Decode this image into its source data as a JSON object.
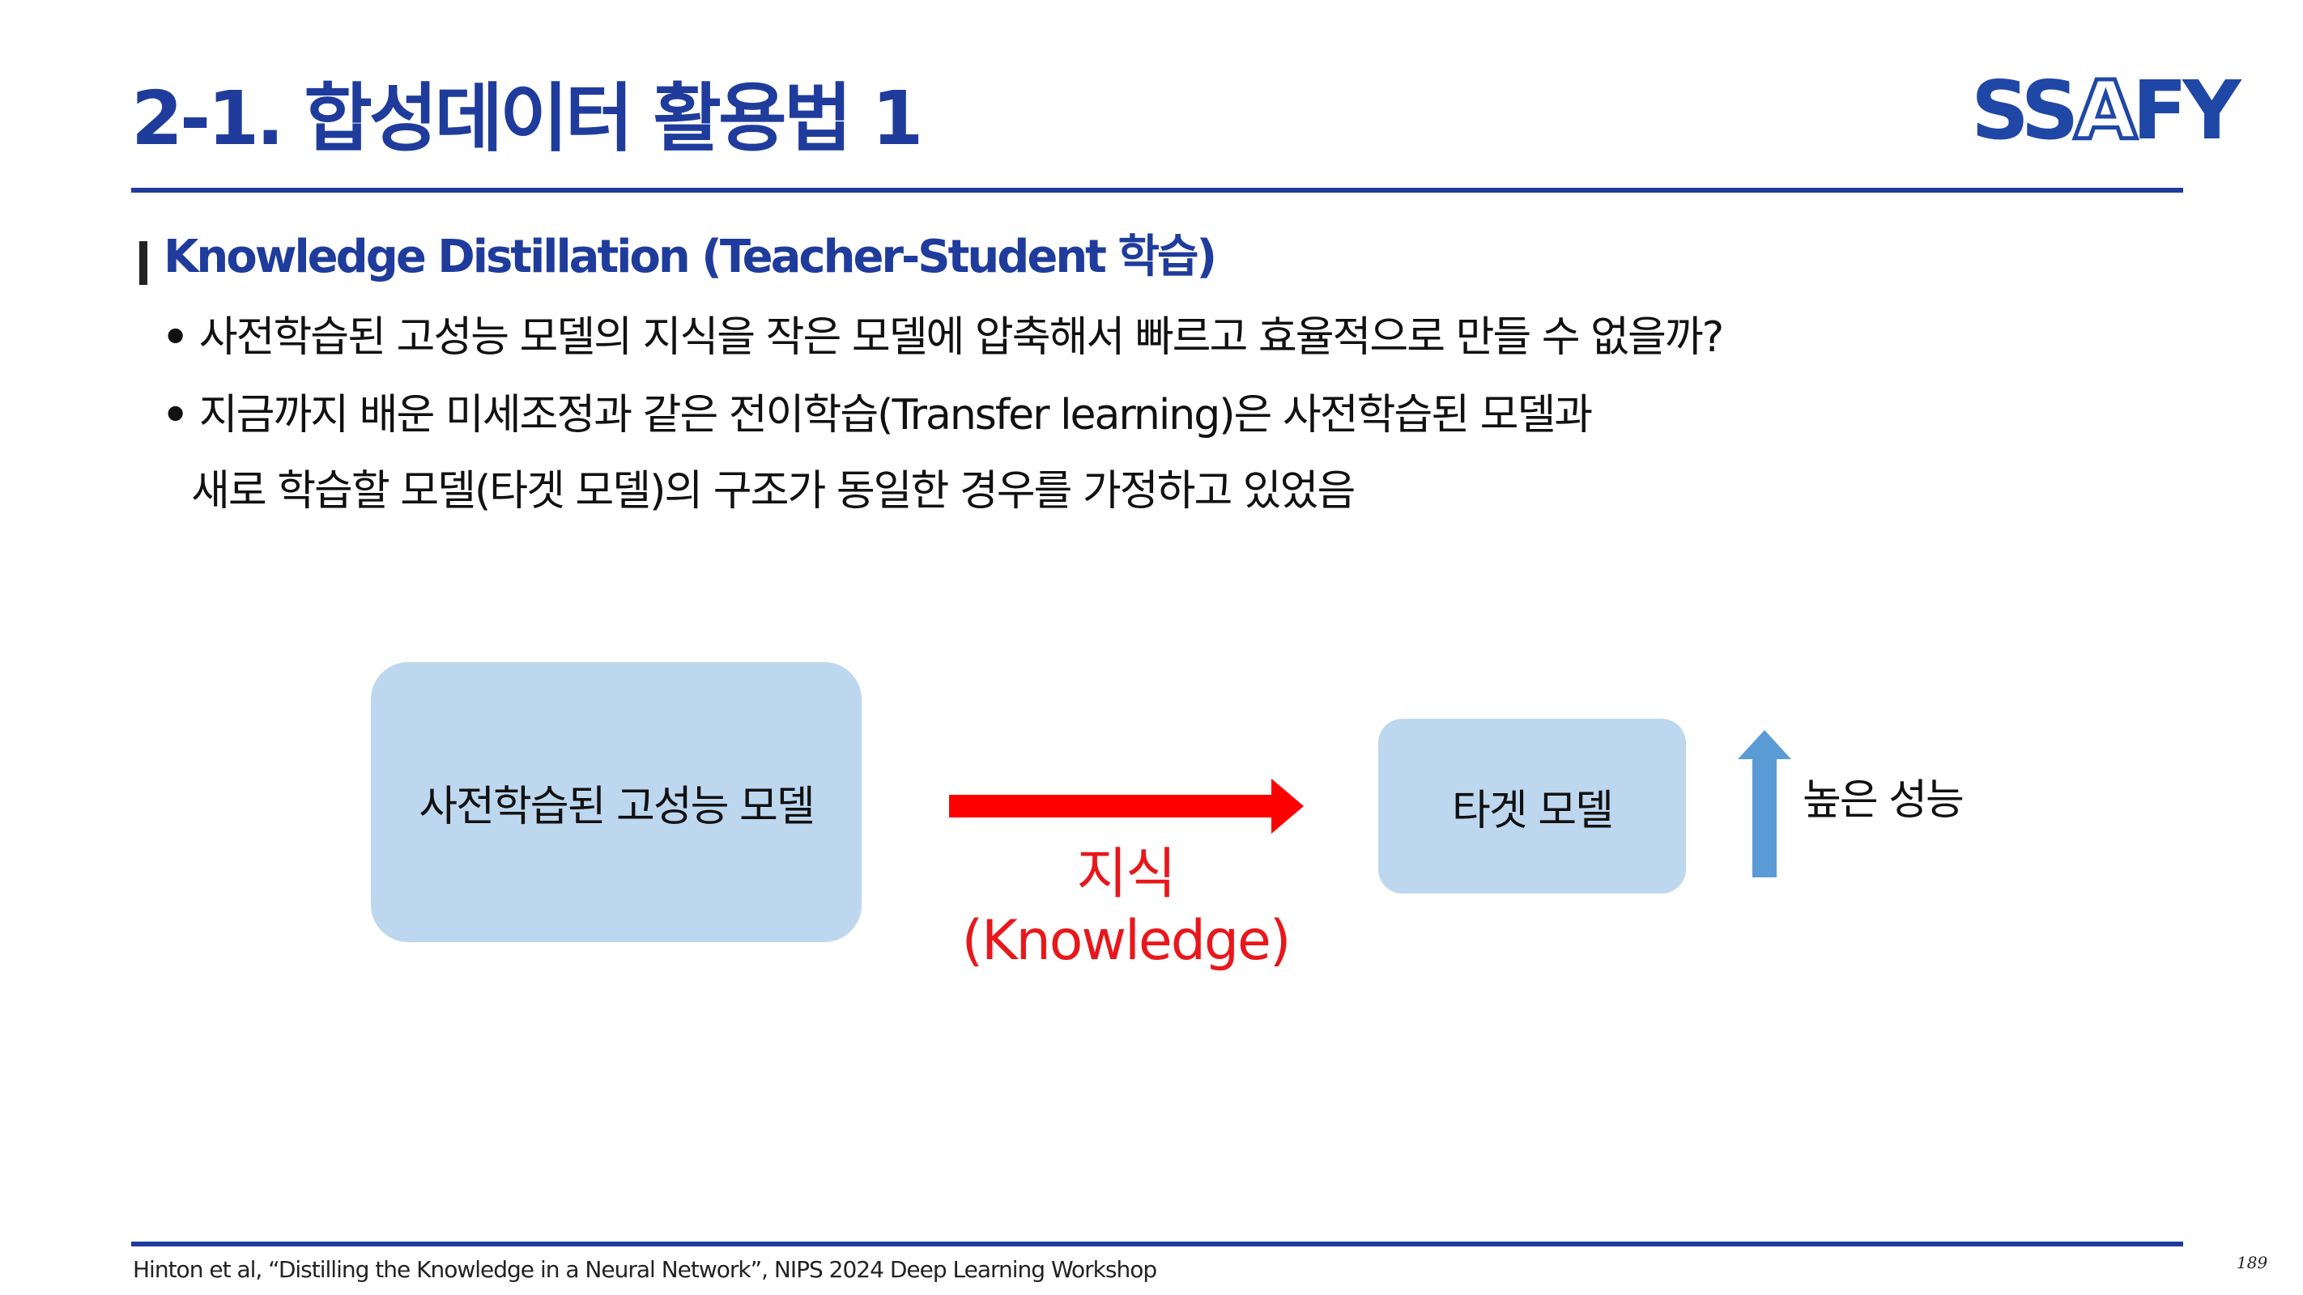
{
  "header": {
    "title": "2-1. 합성데이터 활용법 1",
    "logo": {
      "part1": "SS",
      "part2": "A",
      "part3": "FY"
    }
  },
  "section": {
    "heading": "Knowledge Distillation (Teacher-Student 학습)"
  },
  "bullets": [
    {
      "marker": "•",
      "text": "사전학습된 고성능 모델의 지식을 작은 모델에 압축해서 빠르고 효율적으로 만들 수 없을까?"
    },
    {
      "marker": "•",
      "text": "지금까지 배운 미세조정과 같은 전이학습(Transfer learning)은 사전학습된 모델과",
      "continuation": "새로 학습할 모델(타겟 모델)의 구조가 동일한 경우를 가정하고 있었음"
    }
  ],
  "diagram": {
    "teacher_label": "사전학습된 고성능 모델",
    "student_label": "타겟 모델",
    "knowledge_label_ko": "지식",
    "knowledge_label_en": "(Knowledge)",
    "performance_label": "높은 성능",
    "colors": {
      "box_fill": "#BDD7EE",
      "arrow_red": "#FF0000",
      "arrow_blue": "#5B9BD5",
      "knowledge_text": "#E8171B"
    }
  },
  "footer": {
    "citation": "Hinton et al, “Distilling the Knowledge in a Neural Network”, NIPS 2024 Deep Learning Workshop",
    "page_number": "189"
  },
  "theme": {
    "primary": "#1F3C9C"
  }
}
